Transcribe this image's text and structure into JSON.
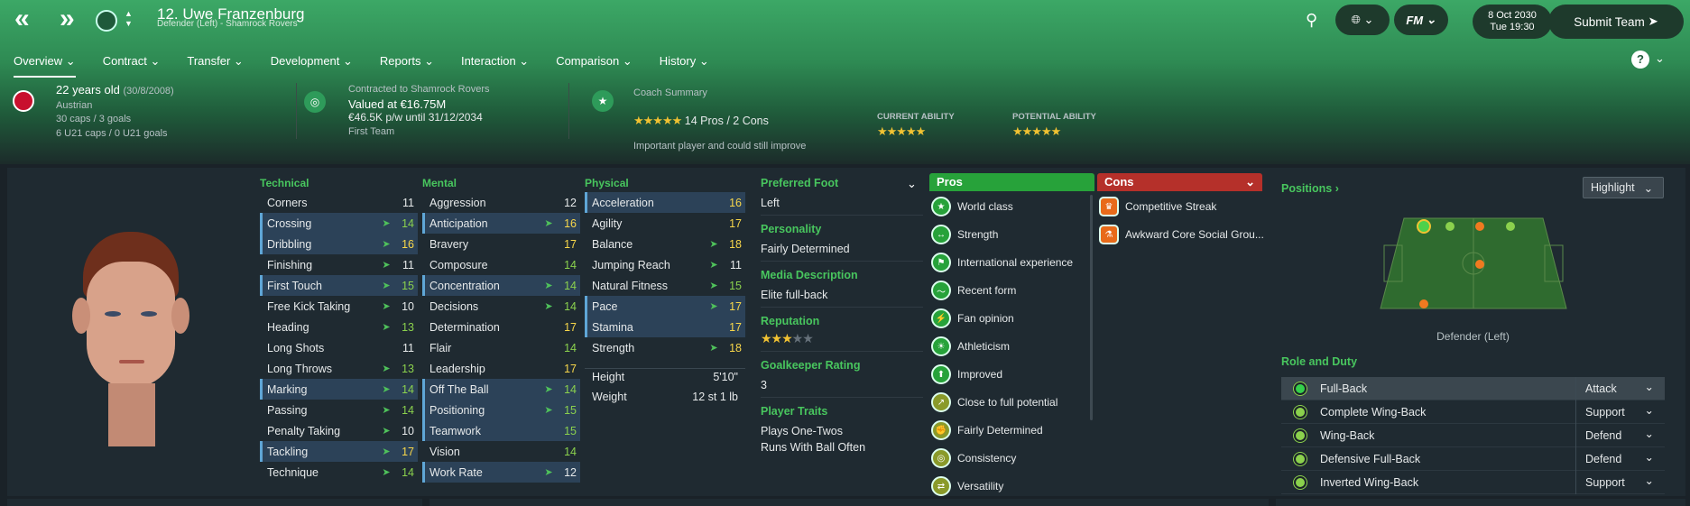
{
  "header": {
    "title": "12. Uwe Franzenburg",
    "subtitle": "Defender (Left) - Shamrock Rovers",
    "date": "8 Oct 2030",
    "time": "Tue 19:30",
    "submit": "Submit Team",
    "fm": "FM"
  },
  "tabs": [
    "Overview",
    "Contract",
    "Transfer",
    "Development",
    "Reports",
    "Interaction",
    "Comparison",
    "History"
  ],
  "info": {
    "age": "22 years old",
    "dob": "(30/8/2008)",
    "nationality": "Austrian",
    "caps": "30 caps / 3 goals",
    "u21": "6 U21 caps / 0 U21 goals",
    "contract_to": "Contracted to Shamrock Rovers",
    "valued": "Valued at €16.75M",
    "wage": "€46.5K p/w until 31/12/2034",
    "squad": "First Team",
    "coach_title": "Coach Summary",
    "pros_cons": "14 Pros / 2 Cons",
    "coach_note": "Important player and could still improve",
    "ca_label": "CURRENT ABILITY",
    "pa_label": "POTENTIAL ABILITY"
  },
  "attributes": {
    "technical_label": "Technical",
    "mental_label": "Mental",
    "physical_label": "Physical",
    "technical": [
      [
        "Corners",
        "11"
      ],
      [
        "Crossing",
        "14"
      ],
      [
        "Dribbling",
        "16"
      ],
      [
        "Finishing",
        "11"
      ],
      [
        "First Touch",
        "15"
      ],
      [
        "Free Kick Taking",
        "10"
      ],
      [
        "Heading",
        "13"
      ],
      [
        "Long Shots",
        "11"
      ],
      [
        "Long Throws",
        "13"
      ],
      [
        "Marking",
        "14"
      ],
      [
        "Passing",
        "14"
      ],
      [
        "Penalty Taking",
        "10"
      ],
      [
        "Tackling",
        "17"
      ],
      [
        "Technique",
        "14"
      ]
    ],
    "mental": [
      [
        "Aggression",
        "12"
      ],
      [
        "Anticipation",
        "16"
      ],
      [
        "Bravery",
        "17"
      ],
      [
        "Composure",
        "14"
      ],
      [
        "Concentration",
        "14"
      ],
      [
        "Decisions",
        "14"
      ],
      [
        "Determination",
        "17"
      ],
      [
        "Flair",
        "14"
      ],
      [
        "Leadership",
        "17"
      ],
      [
        "Off The Ball",
        "14"
      ],
      [
        "Positioning",
        "15"
      ],
      [
        "Teamwork",
        "15"
      ],
      [
        "Vision",
        "14"
      ],
      [
        "Work Rate",
        "12"
      ]
    ],
    "physical": [
      [
        "Acceleration",
        "16"
      ],
      [
        "Agility",
        "17"
      ],
      [
        "Balance",
        "18"
      ],
      [
        "Jumping Reach",
        "11"
      ],
      [
        "Natural Fitness",
        "15"
      ],
      [
        "Pace",
        "17"
      ],
      [
        "Stamina",
        "17"
      ],
      [
        "Strength",
        "18"
      ]
    ],
    "height_label": "Height",
    "height": "5'10\"",
    "weight_label": "Weight",
    "weight": "12 st 1 lb"
  },
  "details": {
    "foot_label": "Preferred Foot",
    "foot": "Left",
    "personality_label": "Personality",
    "personality": "Fairly Determined",
    "media_label": "Media Description",
    "media": "Elite full-back",
    "rep_label": "Reputation",
    "gk_label": "Goalkeeper Rating",
    "gk": "3",
    "traits_label": "Player Traits",
    "traits": [
      "Plays One-Twos",
      "Runs With Ball Often"
    ]
  },
  "pros_label": "Pros",
  "cons_label": "Cons",
  "pros": [
    "World class",
    "Strength",
    "International experience",
    "Recent form",
    "Fan opinion",
    "Athleticism",
    "Improved",
    "Close to full potential",
    "Fairly Determined",
    "Consistency",
    "Versatility"
  ],
  "cons": [
    "Competitive Streak",
    "Awkward Core Social Grou..."
  ],
  "positions": {
    "label": "Positions",
    "highlight": "Highlight",
    "position": "Defender (Left)",
    "role_label": "Role and Duty",
    "roles": [
      [
        "Full-Back",
        "Attack"
      ],
      [
        "Complete Wing-Back",
        "Support"
      ],
      [
        "Wing-Back",
        "Defend"
      ],
      [
        "Defensive Full-Back",
        "Defend"
      ],
      [
        "Inverted Wing-Back",
        "Support"
      ]
    ]
  },
  "colors": {
    "accent": "#48c65e",
    "value_yellow": "#f7d64a",
    "value_green": "#8bd14d",
    "pros": "#27a23a",
    "cons": "#b5302a"
  }
}
